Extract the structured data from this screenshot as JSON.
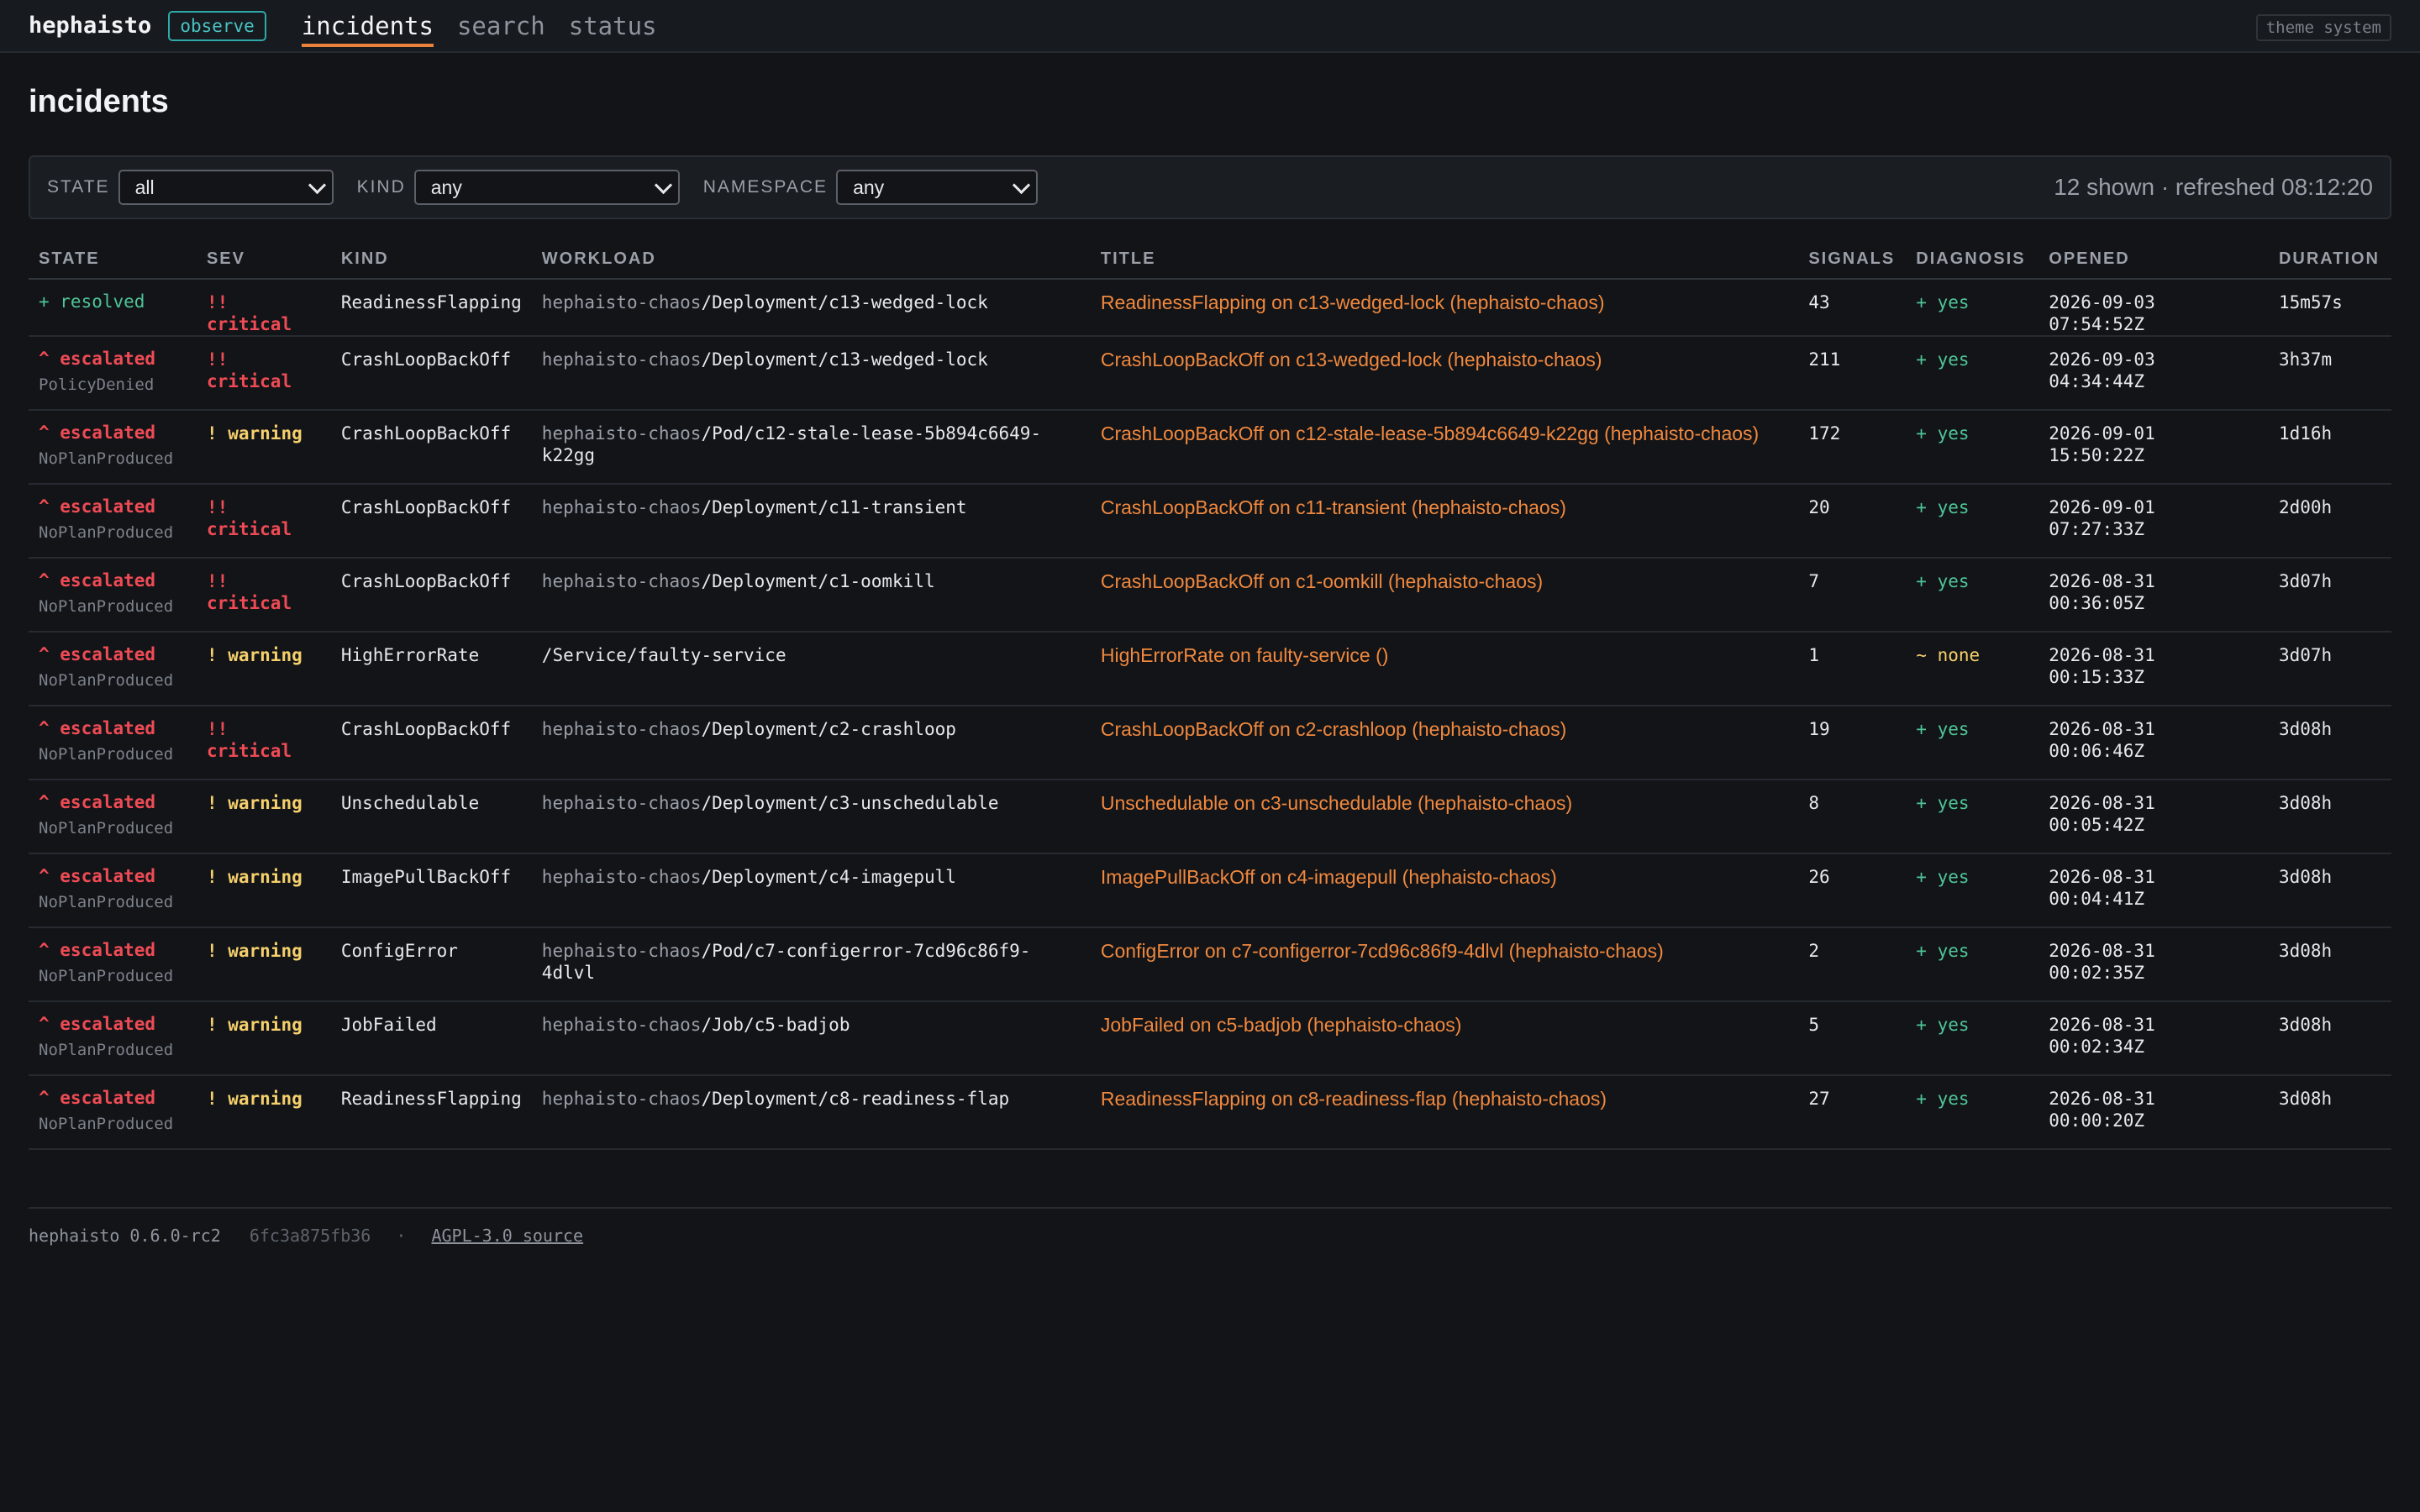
{
  "header": {
    "brand": "hephaisto",
    "mode_badge": "observe",
    "tabs": [
      {
        "label": "incidents",
        "active": true
      },
      {
        "label": "search",
        "active": false
      },
      {
        "label": "status",
        "active": false
      }
    ],
    "theme_button": "theme system"
  },
  "page": {
    "title": "incidents"
  },
  "filters": {
    "state_label": "STATE",
    "state_value": "all",
    "kind_label": "KIND",
    "kind_value": "any",
    "namespace_label": "NAMESPACE",
    "namespace_value": "any",
    "summary": "12 shown · refreshed 08:12:20"
  },
  "table": {
    "columns": [
      "STATE",
      "SEV",
      "KIND",
      "WORKLOAD",
      "TITLE",
      "SIGNALS",
      "DIAGNOSIS",
      "OPENED",
      "DURATION"
    ],
    "rows": [
      {
        "state": "+ resolved",
        "state_class": "resolved",
        "reason": "",
        "sev": "!! critical",
        "sev_class": "critical",
        "kind": "ReadinessFlapping",
        "ns": "hephaisto-chaos",
        "workload": "/Deployment/c13-wedged-lock",
        "title": "ReadinessFlapping on c13-wedged-lock (hephaisto-chaos)",
        "signals": "43",
        "diagnosis": "+ yes",
        "diag_class": "yes",
        "opened": "2026-09-03 07:54:52Z",
        "duration": "15m57s"
      },
      {
        "state": "^ escalated",
        "state_class": "escalated",
        "reason": "PolicyDenied",
        "sev": "!! critical",
        "sev_class": "critical",
        "kind": "CrashLoopBackOff",
        "ns": "hephaisto-chaos",
        "workload": "/Deployment/c13-wedged-lock",
        "title": "CrashLoopBackOff on c13-wedged-lock (hephaisto-chaos)",
        "signals": "211",
        "diagnosis": "+ yes",
        "diag_class": "yes",
        "opened": "2026-09-03 04:34:44Z",
        "duration": "3h37m"
      },
      {
        "state": "^ escalated",
        "state_class": "escalated",
        "reason": "NoPlanProduced",
        "sev": "! warning",
        "sev_class": "warning",
        "kind": "CrashLoopBackOff",
        "ns": "hephaisto-chaos",
        "workload": "/Pod/c12-stale-lease-5b894c6649-k22gg",
        "title": "CrashLoopBackOff on c12-stale-lease-5b894c6649-k22gg (hephaisto-chaos)",
        "signals": "172",
        "diagnosis": "+ yes",
        "diag_class": "yes",
        "opened": "2026-09-01 15:50:22Z",
        "duration": "1d16h"
      },
      {
        "state": "^ escalated",
        "state_class": "escalated",
        "reason": "NoPlanProduced",
        "sev": "!! critical",
        "sev_class": "critical",
        "kind": "CrashLoopBackOff",
        "ns": "hephaisto-chaos",
        "workload": "/Deployment/c11-transient",
        "title": "CrashLoopBackOff on c11-transient (hephaisto-chaos)",
        "signals": "20",
        "diagnosis": "+ yes",
        "diag_class": "yes",
        "opened": "2026-09-01 07:27:33Z",
        "duration": "2d00h"
      },
      {
        "state": "^ escalated",
        "state_class": "escalated",
        "reason": "NoPlanProduced",
        "sev": "!! critical",
        "sev_class": "critical",
        "kind": "CrashLoopBackOff",
        "ns": "hephaisto-chaos",
        "workload": "/Deployment/c1-oomkill",
        "title": "CrashLoopBackOff on c1-oomkill (hephaisto-chaos)",
        "signals": "7",
        "diagnosis": "+ yes",
        "diag_class": "yes",
        "opened": "2026-08-31 00:36:05Z",
        "duration": "3d07h"
      },
      {
        "state": "^ escalated",
        "state_class": "escalated",
        "reason": "NoPlanProduced",
        "sev": "! warning",
        "sev_class": "warning",
        "kind": "HighErrorRate",
        "ns": "",
        "workload": "/Service/faulty-service",
        "title": "HighErrorRate on faulty-service ()",
        "signals": "1",
        "diagnosis": "~ none",
        "diag_class": "none",
        "opened": "2026-08-31 00:15:33Z",
        "duration": "3d07h"
      },
      {
        "state": "^ escalated",
        "state_class": "escalated",
        "reason": "NoPlanProduced",
        "sev": "!! critical",
        "sev_class": "critical",
        "kind": "CrashLoopBackOff",
        "ns": "hephaisto-chaos",
        "workload": "/Deployment/c2-crashloop",
        "title": "CrashLoopBackOff on c2-crashloop (hephaisto-chaos)",
        "signals": "19",
        "diagnosis": "+ yes",
        "diag_class": "yes",
        "opened": "2026-08-31 00:06:46Z",
        "duration": "3d08h"
      },
      {
        "state": "^ escalated",
        "state_class": "escalated",
        "reason": "NoPlanProduced",
        "sev": "! warning",
        "sev_class": "warning",
        "kind": "Unschedulable",
        "ns": "hephaisto-chaos",
        "workload": "/Deployment/c3-unschedulable",
        "title": "Unschedulable on c3-unschedulable (hephaisto-chaos)",
        "signals": "8",
        "diagnosis": "+ yes",
        "diag_class": "yes",
        "opened": "2026-08-31 00:05:42Z",
        "duration": "3d08h"
      },
      {
        "state": "^ escalated",
        "state_class": "escalated",
        "reason": "NoPlanProduced",
        "sev": "! warning",
        "sev_class": "warning",
        "kind": "ImagePullBackOff",
        "ns": "hephaisto-chaos",
        "workload": "/Deployment/c4-imagepull",
        "title": "ImagePullBackOff on c4-imagepull (hephaisto-chaos)",
        "signals": "26",
        "diagnosis": "+ yes",
        "diag_class": "yes",
        "opened": "2026-08-31 00:04:41Z",
        "duration": "3d08h"
      },
      {
        "state": "^ escalated",
        "state_class": "escalated",
        "reason": "NoPlanProduced",
        "sev": "! warning",
        "sev_class": "warning",
        "kind": "ConfigError",
        "ns": "hephaisto-chaos",
        "workload": "/Pod/c7-configerror-7cd96c86f9-4dlvl",
        "title": "ConfigError on c7-configerror-7cd96c86f9-4dlvl (hephaisto-chaos)",
        "signals": "2",
        "diagnosis": "+ yes",
        "diag_class": "yes",
        "opened": "2026-08-31 00:02:35Z",
        "duration": "3d08h"
      },
      {
        "state": "^ escalated",
        "state_class": "escalated",
        "reason": "NoPlanProduced",
        "sev": "! warning",
        "sev_class": "warning",
        "kind": "JobFailed",
        "ns": "hephaisto-chaos",
        "workload": "/Job/c5-badjob",
        "title": "JobFailed on c5-badjob (hephaisto-chaos)",
        "signals": "5",
        "diagnosis": "+ yes",
        "diag_class": "yes",
        "opened": "2026-08-31 00:02:34Z",
        "duration": "3d08h"
      },
      {
        "state": "^ escalated",
        "state_class": "escalated",
        "reason": "NoPlanProduced",
        "sev": "! warning",
        "sev_class": "warning",
        "kind": "ReadinessFlapping",
        "ns": "hephaisto-chaos",
        "workload": "/Deployment/c8-readiness-flap",
        "title": "ReadinessFlapping on c8-readiness-flap (hephaisto-chaos)",
        "signals": "27",
        "diagnosis": "+ yes",
        "diag_class": "yes",
        "opened": "2026-08-31 00:00:20Z",
        "duration": "3d08h"
      }
    ]
  },
  "footer": {
    "version": "hephaisto 0.6.0-rc2",
    "hash": "6fc3a875fb36",
    "separator": "·",
    "source_link": "AGPL-3.0 source"
  }
}
